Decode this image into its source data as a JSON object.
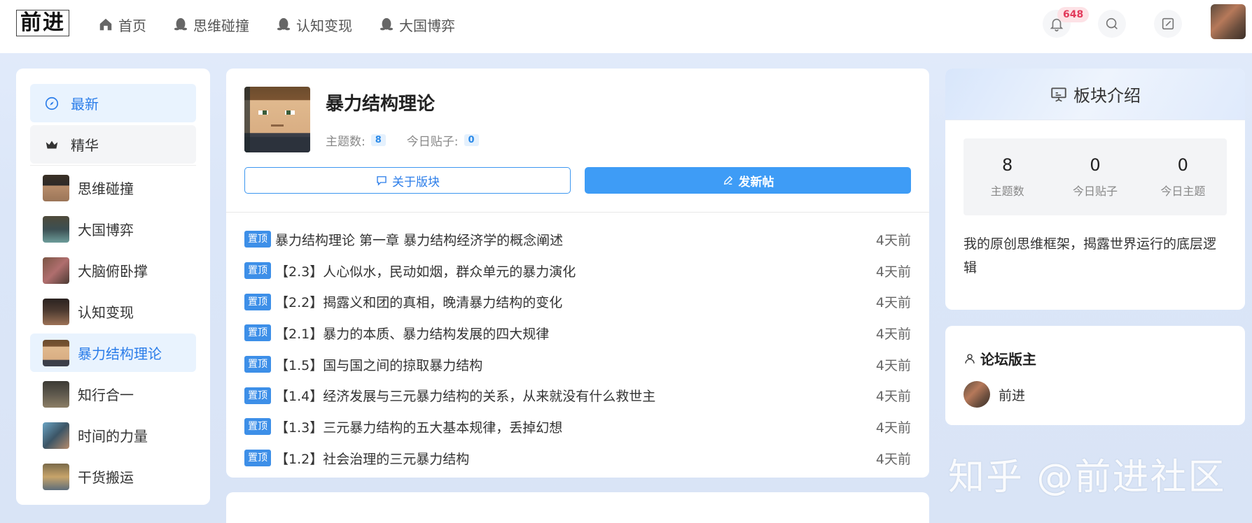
{
  "logo": {
    "text": "前进"
  },
  "nav": [
    {
      "label": "首页",
      "icon": "home-icon"
    },
    {
      "label": "思维碰撞",
      "icon": "qq-penguin-icon"
    },
    {
      "label": "认知变现",
      "icon": "qq-penguin-icon"
    },
    {
      "label": "大国博弈",
      "icon": "qq-penguin-icon"
    }
  ],
  "notifications": {
    "count": "648"
  },
  "sidebar": {
    "items": [
      {
        "label": "最新",
        "icon": "compass-icon"
      },
      {
        "label": "精华",
        "icon": "crown-icon"
      },
      {
        "label": "思维碰撞"
      },
      {
        "label": "大国博弈"
      },
      {
        "label": "大脑俯卧撑"
      },
      {
        "label": "认知变现"
      },
      {
        "label": "暴力结构理论"
      },
      {
        "label": "知行合一"
      },
      {
        "label": "时间的力量"
      },
      {
        "label": "干货搬运"
      }
    ]
  },
  "board": {
    "title": "暴力结构理论",
    "topics_label": "主题数:",
    "topics_value": "8",
    "today_posts_label": "今日贴子:",
    "today_posts_value": "0",
    "about_button": "关于版块",
    "new_post_button": "发新帖"
  },
  "threads": [
    {
      "tag": "置顶",
      "title": "暴力结构理论 第一章 暴力结构经济学的概念阐述",
      "time": "4天前"
    },
    {
      "tag": "置顶",
      "title": "【2.3】人心似水，民动如烟，群众单元的暴力演化",
      "time": "4天前"
    },
    {
      "tag": "置顶",
      "title": "【2.2】揭露义和团的真相，晚清暴力结构的变化",
      "time": "4天前"
    },
    {
      "tag": "置顶",
      "title": "【2.1】暴力的本质、暴力结构发展的四大规律",
      "time": "4天前"
    },
    {
      "tag": "置顶",
      "title": "【1.5】国与国之间的掠取暴力结构",
      "time": "4天前"
    },
    {
      "tag": "置顶",
      "title": "【1.4】经济发展与三元暴力结构的关系，从来就没有什么救世主",
      "time": "4天前"
    },
    {
      "tag": "置顶",
      "title": "【1.3】三元暴力结构的五大基本规律，丢掉幻想",
      "time": "4天前"
    },
    {
      "tag": "置顶",
      "title": "【1.2】社会治理的三元暴力结构",
      "time": "4天前"
    }
  ],
  "intro": {
    "header": "板块介绍",
    "stats": [
      {
        "value": "8",
        "label": "主题数"
      },
      {
        "value": "0",
        "label": "今日贴子"
      },
      {
        "value": "0",
        "label": "今日主题"
      }
    ],
    "description": "我的原创思维框架，揭露世界运行的底层逻辑"
  },
  "moderators": {
    "title": "论坛版主",
    "users": [
      {
        "name": "前进"
      }
    ]
  },
  "watermark": "知乎 @前进社区",
  "colors": {
    "accent": "#3e9cf6",
    "badge": "#e23a5b"
  }
}
